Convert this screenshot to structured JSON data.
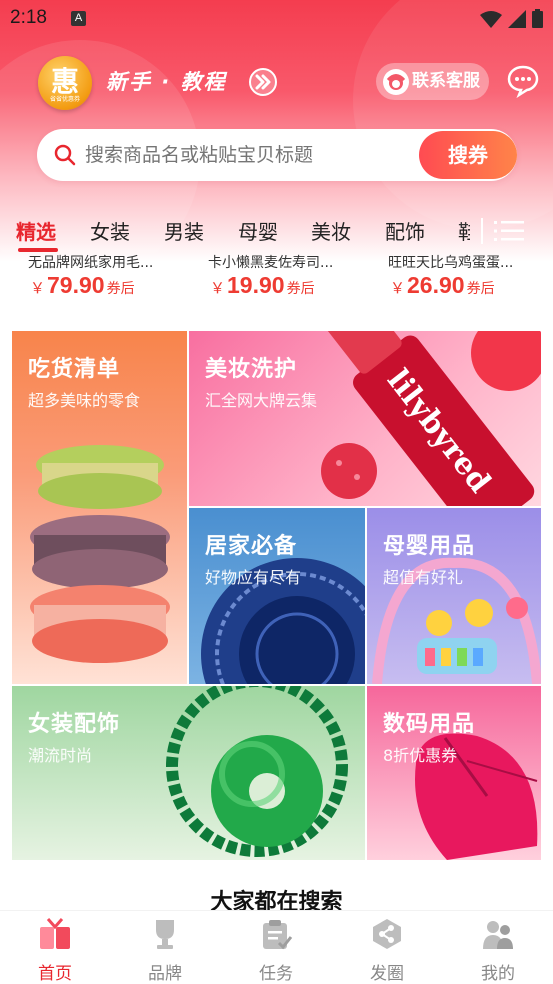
{
  "status_bar": {
    "time": "2:18",
    "sim_badge": "A"
  },
  "header": {
    "logo_glyph": "惠",
    "logo_subtitle": "省省优惠券",
    "tutorial_label": "新手 · 教程",
    "service_button_label": "联系客服"
  },
  "search": {
    "placeholder": "搜索商品名或粘贴宝贝标题",
    "button_label": "搜券"
  },
  "tabs": [
    {
      "label": "精选",
      "active": true
    },
    {
      "label": "女装"
    },
    {
      "label": "男装"
    },
    {
      "label": "母婴"
    },
    {
      "label": "美妆"
    },
    {
      "label": "配饰"
    },
    {
      "label": "鞋"
    }
  ],
  "products": [
    {
      "title": "无品牌网纸家用毛...",
      "currency": "￥",
      "price": "79.90",
      "suffix": "券后"
    },
    {
      "title": "卡小懒黑麦佐寿司...",
      "currency": "￥",
      "price": "19.90",
      "suffix": "券后"
    },
    {
      "title": "旺旺天比乌鸡蛋蛋...",
      "currency": "￥",
      "price": "26.90",
      "suffix": "券后"
    }
  ],
  "categories": [
    {
      "title": "吃货清单",
      "subtitle": "超多美味的零食",
      "bg": "#f8844b"
    },
    {
      "title": "美妆洗护",
      "subtitle": "汇全网大牌云集",
      "bg": "#f86fa0",
      "brand_text": "lilybyred"
    },
    {
      "title": "居家必备",
      "subtitle": "好物应有尽有",
      "bg": "#4a8fd0"
    },
    {
      "title": "母婴用品",
      "subtitle": "超值有好礼",
      "bg": "#9b8ee8"
    },
    {
      "title": "女装配饰",
      "subtitle": "潮流时尚",
      "bg": "#9fd6a0"
    },
    {
      "title": "数码用品",
      "subtitle": "8折优惠券",
      "bg": "#f6679b"
    }
  ],
  "section_title": "大家都在搜索",
  "bottom_nav": [
    {
      "label": "首页",
      "icon": "home-icon",
      "active": true
    },
    {
      "label": "品牌",
      "icon": "trophy-icon"
    },
    {
      "label": "任务",
      "icon": "task-icon"
    },
    {
      "label": "发圈",
      "icon": "share-icon"
    },
    {
      "label": "我的",
      "icon": "profile-icon"
    }
  ],
  "colors": {
    "accent": "#e8262e",
    "price": "#ee3b32",
    "header_top": "#f43d4f"
  }
}
